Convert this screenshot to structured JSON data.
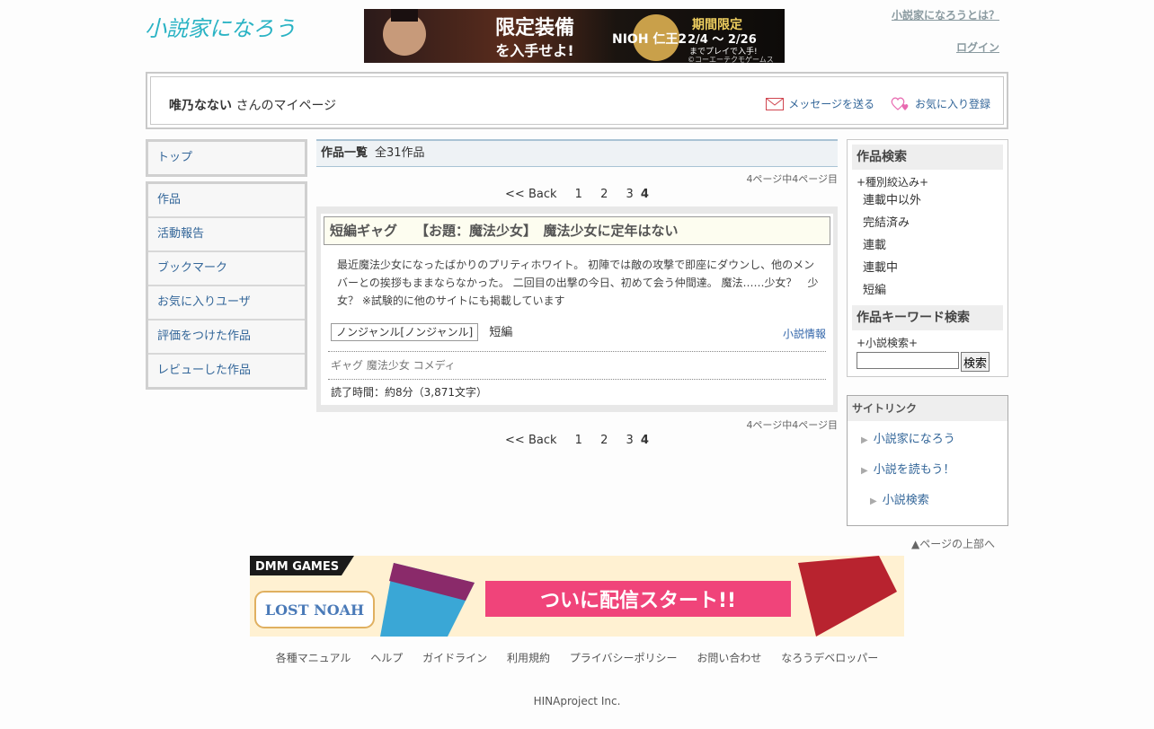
{
  "header": {
    "logo_text": "小説家になろう",
    "top_banner": {
      "text_main": "限定装備",
      "text_sub": "を入手せよ!",
      "game": "NIOH 仁王2",
      "period_title": "期間限定",
      "period": "2/4 ～ 2/26",
      "period_note": "までプレイで入手!",
      "copyright": "©コーエーテクモゲームス"
    },
    "about_link": "小説家になろうとは？",
    "login_link": "ログイン"
  },
  "userbox": {
    "name": "唯乃なない",
    "suffix": " さんのマイページ",
    "send_message": "メッセージを送る",
    "add_favorite": "お気に入り登録"
  },
  "leftnav": {
    "top": "トップ",
    "items": [
      "作品",
      "活動報告",
      "ブックマーク",
      "お気に入りユーザ",
      "評価をつけた作品",
      "レビューした作品"
    ]
  },
  "main": {
    "heading": "作品一覧",
    "count": "全31作品",
    "page_info": "4ページ中4ページ目",
    "pager": {
      "back": "<< Back",
      "pages": [
        "1",
        "2",
        "3"
      ],
      "current": "4"
    },
    "work": {
      "genre_tag": "短編ギャグ",
      "title": "【お題：魔法少女】　魔法少女に定年はない",
      "synopsis": "最近魔法少女になったばかりのプリティホワイト。 初陣では敵の攻撃で即座にダウンし、他のメンバーとの挨拶もままならなかった。 二回目の出撃の今日、初めて会う仲間達。 魔法……少女？　少女？ ※試験的に他のサイトにも掲載しています",
      "genre": "ノンジャンル[ノンジャンル]",
      "kind": "短編",
      "info_link": "小説情報",
      "keywords": "ギャグ 魔法少女 コメディ",
      "read_time": "読了時間：約8分（3,871文字）"
    }
  },
  "right": {
    "search_title": "作品検索",
    "filter_label": "+種別絞込み+",
    "filters": [
      "連載中以外",
      "完結済み",
      "連載",
      "連載中",
      "短編"
    ],
    "keyword_title": "作品キーワード検索",
    "keyword_label": "+小説検索+",
    "keyword_value": "",
    "search_button": "検索",
    "sitelink_title": "サイトリンク",
    "sitelinks": [
      "小説家になろう",
      "小説を読もう！",
      "小説検索"
    ]
  },
  "pagetop": "▲ページの上部へ",
  "bottom_banner": {
    "brand": "DMM GAMES",
    "game": "LOST NOAH",
    "text": "ついに配信スタート!!"
  },
  "footer": {
    "links": [
      "各種マニュアル",
      "ヘルプ",
      "ガイドライン",
      "利用規約",
      "プライバシーポリシー",
      "お問い合わせ",
      "なろうデベロッパー"
    ],
    "copyright": "HINAproject Inc."
  },
  "colors": {
    "link": "#336699",
    "heading_border": "#a9c3d4",
    "title_bg": "#fdfdf0"
  }
}
